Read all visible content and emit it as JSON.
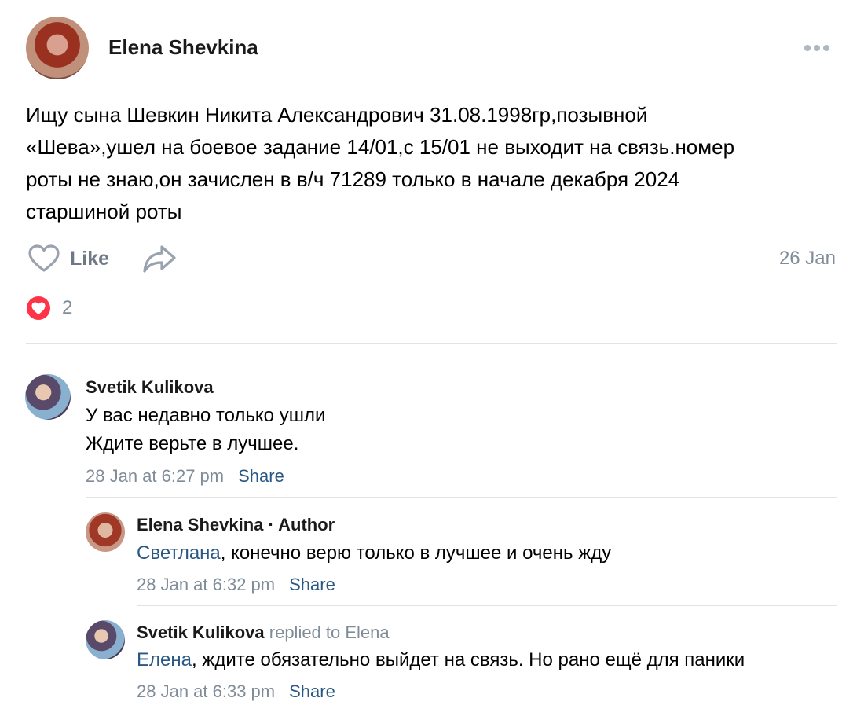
{
  "post": {
    "author": "Elena Shevkina",
    "text_lines": [
      "Ищу сына Шевкин Никита Александрович 31.08.1998гр,позывной",
      "«Шева»,ушел на боевое задание 14/01,с 15/01 не выходит на связь.номер",
      "роты не знаю,он зачислен в в/ч 71289 только в начале декабря 2024",
      "старшиной роты"
    ],
    "like_label": "Like",
    "date": "26 Jan",
    "reaction_count": "2",
    "icons": {
      "more": "more-icon",
      "like": "heart-outline-icon",
      "share": "share-arrow-icon",
      "reaction": "heart-filled-icon"
    },
    "colors": {
      "reaction": "#ff3347",
      "link": "#2a5885",
      "muted": "#818c99"
    }
  },
  "comments": [
    {
      "author": "Svetik Kulikova",
      "lines": [
        "У вас недавно только ушли",
        "Ждите верьте в лучшее."
      ],
      "time": "28 Jan at 6:27 pm",
      "share": "Share"
    },
    {
      "author": "Elena Shevkina",
      "author_suffix": " · Author",
      "mention": "Светлана",
      "text": ", конечно верю только в лучшее и очень жду",
      "time": "28 Jan at 6:32 pm",
      "share": "Share"
    },
    {
      "author": "Svetik Kulikova",
      "reply_note": " replied to Elena",
      "mention": "Елена",
      "text": ", ждите обязательно выйдет на связь. Но рано ещё для паники",
      "time": "28 Jan at 6:33 pm",
      "share": "Share"
    }
  ]
}
